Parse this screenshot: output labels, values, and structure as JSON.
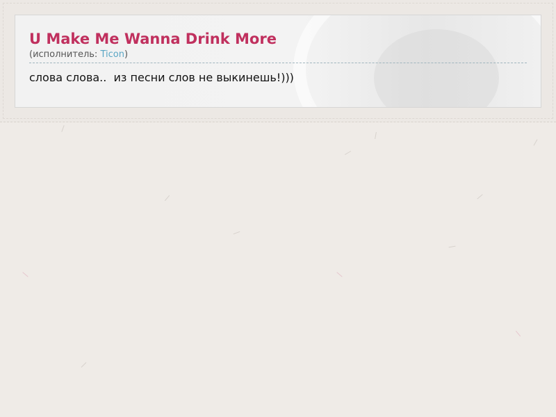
{
  "song": {
    "title": "U Make Me Wanna Drink More",
    "artist_prefix": "(исполнитель: ",
    "artist_name": "Ticon",
    "artist_suffix": ")",
    "lyrics": "слова слова..  из песни слов не выкинешь!)))"
  },
  "colors": {
    "title": "#c0305e",
    "artist_link": "#5aa6c4",
    "page_background": "#efebe7"
  }
}
